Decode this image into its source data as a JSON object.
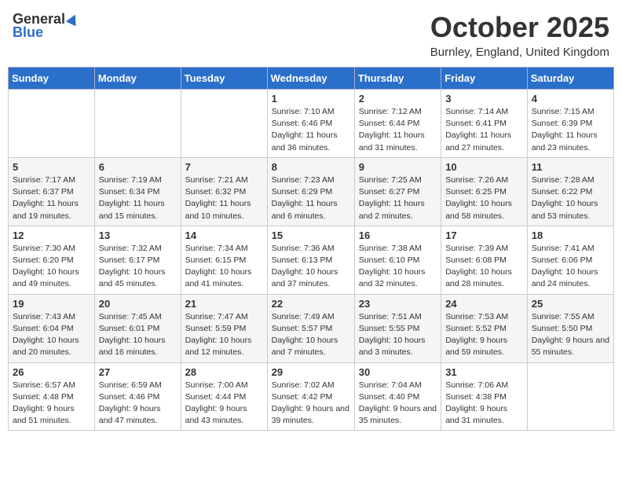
{
  "header": {
    "logo_general": "General",
    "logo_blue": "Blue",
    "title": "October 2025",
    "location": "Burnley, England, United Kingdom"
  },
  "weekdays": [
    "Sunday",
    "Monday",
    "Tuesday",
    "Wednesday",
    "Thursday",
    "Friday",
    "Saturday"
  ],
  "weeks": [
    [
      {
        "day": "",
        "info": ""
      },
      {
        "day": "",
        "info": ""
      },
      {
        "day": "",
        "info": ""
      },
      {
        "day": "1",
        "info": "Sunrise: 7:10 AM\nSunset: 6:46 PM\nDaylight: 11 hours and 36 minutes."
      },
      {
        "day": "2",
        "info": "Sunrise: 7:12 AM\nSunset: 6:44 PM\nDaylight: 11 hours and 31 minutes."
      },
      {
        "day": "3",
        "info": "Sunrise: 7:14 AM\nSunset: 6:41 PM\nDaylight: 11 hours and 27 minutes."
      },
      {
        "day": "4",
        "info": "Sunrise: 7:15 AM\nSunset: 6:39 PM\nDaylight: 11 hours and 23 minutes."
      }
    ],
    [
      {
        "day": "5",
        "info": "Sunrise: 7:17 AM\nSunset: 6:37 PM\nDaylight: 11 hours and 19 minutes."
      },
      {
        "day": "6",
        "info": "Sunrise: 7:19 AM\nSunset: 6:34 PM\nDaylight: 11 hours and 15 minutes."
      },
      {
        "day": "7",
        "info": "Sunrise: 7:21 AM\nSunset: 6:32 PM\nDaylight: 11 hours and 10 minutes."
      },
      {
        "day": "8",
        "info": "Sunrise: 7:23 AM\nSunset: 6:29 PM\nDaylight: 11 hours and 6 minutes."
      },
      {
        "day": "9",
        "info": "Sunrise: 7:25 AM\nSunset: 6:27 PM\nDaylight: 11 hours and 2 minutes."
      },
      {
        "day": "10",
        "info": "Sunrise: 7:26 AM\nSunset: 6:25 PM\nDaylight: 10 hours and 58 minutes."
      },
      {
        "day": "11",
        "info": "Sunrise: 7:28 AM\nSunset: 6:22 PM\nDaylight: 10 hours and 53 minutes."
      }
    ],
    [
      {
        "day": "12",
        "info": "Sunrise: 7:30 AM\nSunset: 6:20 PM\nDaylight: 10 hours and 49 minutes."
      },
      {
        "day": "13",
        "info": "Sunrise: 7:32 AM\nSunset: 6:17 PM\nDaylight: 10 hours and 45 minutes."
      },
      {
        "day": "14",
        "info": "Sunrise: 7:34 AM\nSunset: 6:15 PM\nDaylight: 10 hours and 41 minutes."
      },
      {
        "day": "15",
        "info": "Sunrise: 7:36 AM\nSunset: 6:13 PM\nDaylight: 10 hours and 37 minutes."
      },
      {
        "day": "16",
        "info": "Sunrise: 7:38 AM\nSunset: 6:10 PM\nDaylight: 10 hours and 32 minutes."
      },
      {
        "day": "17",
        "info": "Sunrise: 7:39 AM\nSunset: 6:08 PM\nDaylight: 10 hours and 28 minutes."
      },
      {
        "day": "18",
        "info": "Sunrise: 7:41 AM\nSunset: 6:06 PM\nDaylight: 10 hours and 24 minutes."
      }
    ],
    [
      {
        "day": "19",
        "info": "Sunrise: 7:43 AM\nSunset: 6:04 PM\nDaylight: 10 hours and 20 minutes."
      },
      {
        "day": "20",
        "info": "Sunrise: 7:45 AM\nSunset: 6:01 PM\nDaylight: 10 hours and 16 minutes."
      },
      {
        "day": "21",
        "info": "Sunrise: 7:47 AM\nSunset: 5:59 PM\nDaylight: 10 hours and 12 minutes."
      },
      {
        "day": "22",
        "info": "Sunrise: 7:49 AM\nSunset: 5:57 PM\nDaylight: 10 hours and 7 minutes."
      },
      {
        "day": "23",
        "info": "Sunrise: 7:51 AM\nSunset: 5:55 PM\nDaylight: 10 hours and 3 minutes."
      },
      {
        "day": "24",
        "info": "Sunrise: 7:53 AM\nSunset: 5:52 PM\nDaylight: 9 hours and 59 minutes."
      },
      {
        "day": "25",
        "info": "Sunrise: 7:55 AM\nSunset: 5:50 PM\nDaylight: 9 hours and 55 minutes."
      }
    ],
    [
      {
        "day": "26",
        "info": "Sunrise: 6:57 AM\nSunset: 4:48 PM\nDaylight: 9 hours and 51 minutes."
      },
      {
        "day": "27",
        "info": "Sunrise: 6:59 AM\nSunset: 4:46 PM\nDaylight: 9 hours and 47 minutes."
      },
      {
        "day": "28",
        "info": "Sunrise: 7:00 AM\nSunset: 4:44 PM\nDaylight: 9 hours and 43 minutes."
      },
      {
        "day": "29",
        "info": "Sunrise: 7:02 AM\nSunset: 4:42 PM\nDaylight: 9 hours and 39 minutes."
      },
      {
        "day": "30",
        "info": "Sunrise: 7:04 AM\nSunset: 4:40 PM\nDaylight: 9 hours and 35 minutes."
      },
      {
        "day": "31",
        "info": "Sunrise: 7:06 AM\nSunset: 4:38 PM\nDaylight: 9 hours and 31 minutes."
      },
      {
        "day": "",
        "info": ""
      }
    ]
  ]
}
